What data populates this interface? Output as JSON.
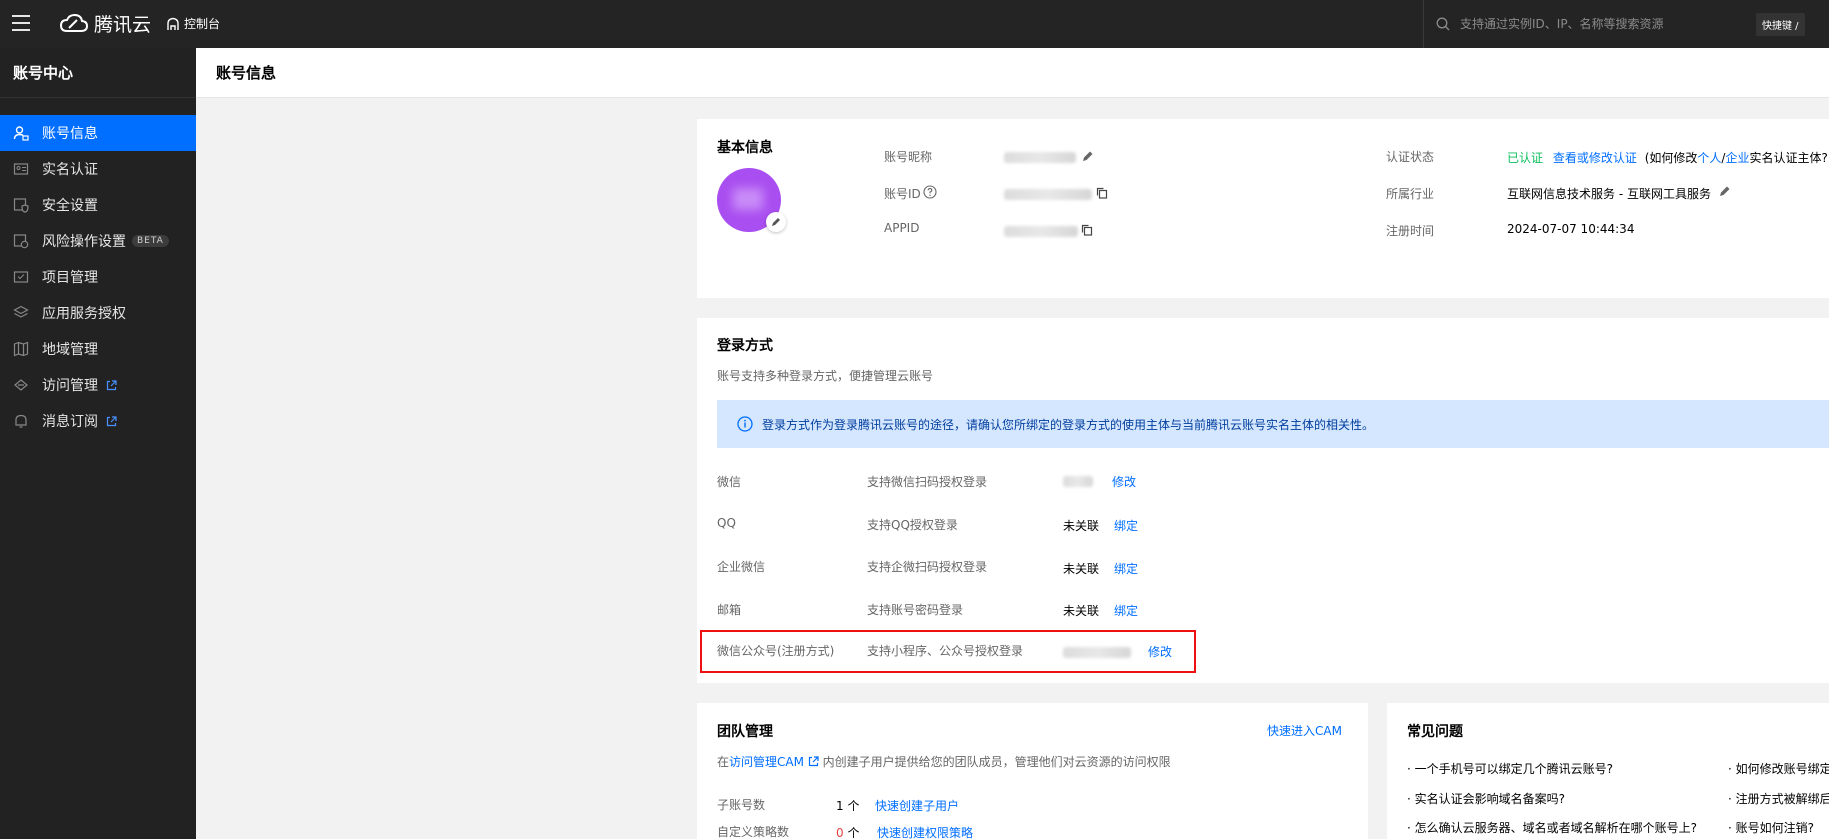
{
  "topbar": {
    "brand": "腾讯云",
    "console": "控制台",
    "search_placeholder": "支持通过实例ID、IP、名称等搜索资源",
    "shortcut": "快捷键 /"
  },
  "sidebar": {
    "title": "账号中心",
    "items": [
      {
        "label": "账号信息"
      },
      {
        "label": "实名认证"
      },
      {
        "label": "安全设置"
      },
      {
        "label": "风险操作设置",
        "badge": "BETA"
      },
      {
        "label": "项目管理"
      },
      {
        "label": "应用服务授权"
      },
      {
        "label": "地域管理"
      },
      {
        "label": "访问管理"
      },
      {
        "label": "消息订阅"
      }
    ]
  },
  "page": {
    "title": "账号信息"
  },
  "basic": {
    "title": "基本信息",
    "nickname_label": "账号昵称",
    "id_label": "账号ID",
    "appid_label": "APPID",
    "auth_label": "认证状态",
    "auth_status": "已认证",
    "auth_link": "查看或修改认证",
    "auth_hint_pre": "(如何修改",
    "auth_hint_personal": "个人",
    "auth_hint_sep": "/",
    "auth_hint_enterprise": "企业",
    "auth_hint_post": "实名认证主体?",
    "industry_label": "所属行业",
    "industry_value": "互联网信息技术服务 - 互联网工具服务",
    "reg_label": "注册时间",
    "reg_value": "2024-07-07 10:44:34"
  },
  "login": {
    "title": "登录方式",
    "subtitle": "账号支持多种登录方式，便捷管理云账号",
    "notice": "登录方式作为登录腾讯云账号的途径，请确认您所绑定的登录方式的使用主体与当前腾讯云账号实名主体的相关性。",
    "rows": [
      {
        "name": "微信",
        "desc": "支持微信扫码授权登录",
        "status": "",
        "action": "修改"
      },
      {
        "name": "QQ",
        "desc": "支持QQ授权登录",
        "status": "未关联",
        "action": "绑定"
      },
      {
        "name": "企业微信",
        "desc": "支持企微扫码授权登录",
        "status": "未关联",
        "action": "绑定"
      },
      {
        "name": "邮箱",
        "desc": "支持账号密码登录",
        "status": "未关联",
        "action": "绑定"
      },
      {
        "name": "微信公众号(注册方式)",
        "desc": "支持小程序、公众号授权登录",
        "status": "",
        "action": "修改"
      }
    ]
  },
  "team": {
    "title": "团队管理",
    "cam_link": "快速进入CAM",
    "desc_pre": "在",
    "desc_link": "访问管理CAM",
    "desc_post": "内创建子用户提供给您的团队成员，管理他们对云资源的访问权限",
    "sub_label": "子账号数",
    "sub_value": "1 个",
    "sub_link": "快速创建子用户",
    "policy_label": "自定义策略数",
    "policy_value": "0",
    "policy_unit": "个",
    "policy_link": "快速创建权限策略"
  },
  "faq": {
    "title": "常见问题",
    "left": [
      "一个手机号可以绑定几个腾讯云账号?",
      "实名认证会影响域名备案吗?",
      "怎么确认云服务器、域名或者域名解析在哪个账号上?"
    ],
    "right": [
      "如何修改账号绑定",
      "注册方式被解绑后",
      "账号如何注销?"
    ]
  },
  "colors": {
    "accent": "#006eff",
    "success": "#0abf5b",
    "danger": "#e54545",
    "highlight": "#e11"
  }
}
